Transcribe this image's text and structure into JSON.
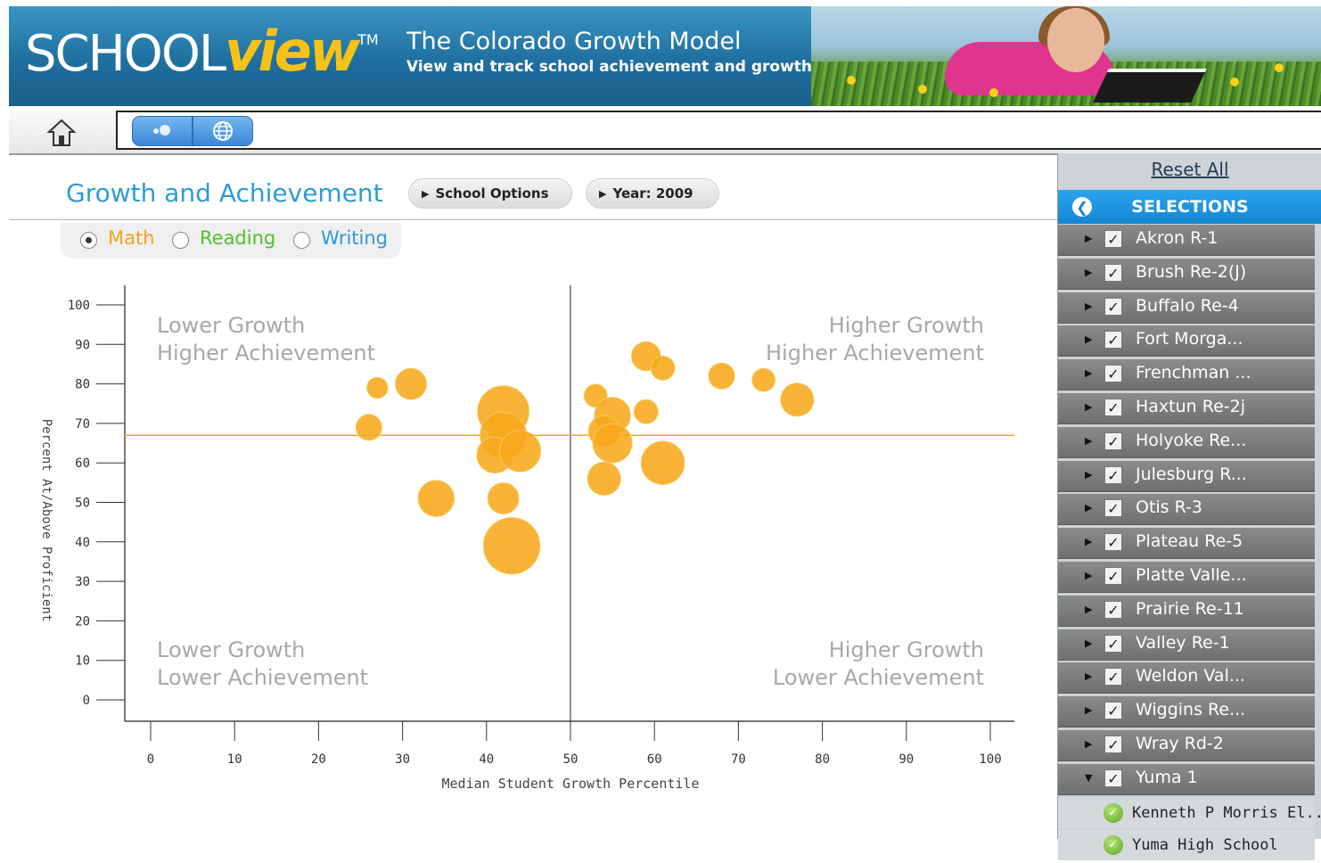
{
  "banner": {
    "logo_school": "SCHOOL",
    "logo_view": "view",
    "logo_tm": "TM",
    "title": "The Colorado Growth Model",
    "subtitle": "View and track school achievement and growth"
  },
  "toolbar": {
    "home_icon": "home-icon",
    "view_buttons": [
      "bubble-chart-icon",
      "globe-icon"
    ]
  },
  "header": {
    "title": "Growth and Achievement",
    "school_options": "School Options",
    "year": "Year: 2009"
  },
  "subjects": [
    {
      "label": "Math",
      "selected": true,
      "color": "#f6a21c"
    },
    {
      "label": "Reading",
      "selected": false,
      "color": "#52c026"
    },
    {
      "label": "Writing",
      "selected": false,
      "color": "#2e9bd6"
    }
  ],
  "colors": {
    "accent": "#2e9bd6",
    "bubble": "#f7a81b",
    "reference_line": "#f5a623"
  },
  "chart_data": {
    "type": "scatter",
    "xlabel": "Median Student Growth Percentile",
    "ylabel": "Percent At/Above Proficient",
    "xlim": [
      0,
      100
    ],
    "ylim": [
      0,
      100
    ],
    "x_ticks": [
      0,
      10,
      20,
      30,
      40,
      50,
      60,
      70,
      80,
      90,
      100
    ],
    "y_ticks": [
      0,
      10,
      20,
      30,
      40,
      50,
      60,
      70,
      80,
      90,
      100
    ],
    "vertical_reference": 50,
    "horizontal_reference": 67,
    "quadrants": {
      "top_left": [
        "Lower Growth",
        "Higher Achievement"
      ],
      "top_right": [
        "Higher Growth",
        "Higher Achievement"
      ],
      "bottom_left": [
        "Lower Growth",
        "Lower Achievement"
      ],
      "bottom_right": [
        "Higher Growth",
        "Lower Achievement"
      ]
    },
    "points": [
      {
        "x": 27,
        "y": 79,
        "size": 1
      },
      {
        "x": 31,
        "y": 80,
        "size": 2
      },
      {
        "x": 26,
        "y": 69,
        "size": 1.5
      },
      {
        "x": 42,
        "y": 73,
        "size": 4
      },
      {
        "x": 42,
        "y": 67,
        "size": 3.5
      },
      {
        "x": 41,
        "y": 62,
        "size": 2.5
      },
      {
        "x": 44,
        "y": 63,
        "size": 3
      },
      {
        "x": 34,
        "y": 51,
        "size": 2.5
      },
      {
        "x": 42,
        "y": 51,
        "size": 2
      },
      {
        "x": 43,
        "y": 39,
        "size": 4.5
      },
      {
        "x": 59,
        "y": 87,
        "size": 1.8
      },
      {
        "x": 61,
        "y": 84,
        "size": 1.3
      },
      {
        "x": 53,
        "y": 77,
        "size": 1.2
      },
      {
        "x": 55,
        "y": 72,
        "size": 2.5
      },
      {
        "x": 59,
        "y": 73,
        "size": 1.3
      },
      {
        "x": 54,
        "y": 68,
        "size": 2
      },
      {
        "x": 55,
        "y": 65,
        "size": 2.8
      },
      {
        "x": 54,
        "y": 56,
        "size": 2.2
      },
      {
        "x": 61,
        "y": 60,
        "size": 3.2
      },
      {
        "x": 68,
        "y": 82,
        "size": 1.5
      },
      {
        "x": 73,
        "y": 81,
        "size": 1.2
      },
      {
        "x": 77,
        "y": 76,
        "size": 2.2
      }
    ]
  },
  "sidebar": {
    "reset": "Reset All",
    "selections": "SELECTIONS",
    "districts": [
      "Akron R-1",
      "Brush Re-2(J)",
      "Buffalo Re-4",
      "Fort Morga...",
      "Frenchman ...",
      "Haxtun Re-2j",
      "Holyoke Re...",
      "Julesburg R...",
      "Otis R-3",
      "Plateau Re-5",
      "Platte Valle...",
      "Prairie Re-11",
      "Valley Re-1",
      "Weldon Val...",
      "Wiggins Re...",
      "Wray Rd-2",
      "Yuma 1"
    ],
    "expanded_district": "Yuma 1",
    "schools": [
      "Kenneth P Morris El...",
      "Yuma High School"
    ]
  }
}
